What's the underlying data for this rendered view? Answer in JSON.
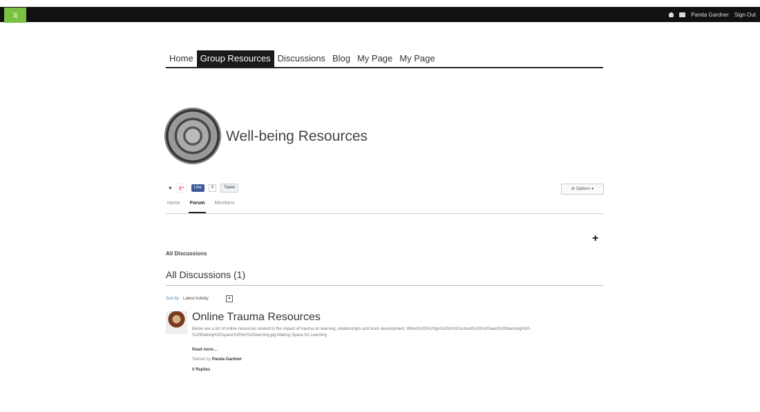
{
  "topbar": {
    "logo_text": "3|",
    "logo_color": "#7bc043",
    "icons": [
      "user-icon",
      "message-icon"
    ],
    "user_name": "Panda Gardner",
    "sign_out": "Sign Out"
  },
  "nav": {
    "items": [
      "Home",
      "Group Resources",
      "Discussions",
      "Blog",
      "My Page",
      "My Page"
    ],
    "active_index": 1
  },
  "group": {
    "title": "Well-being Resources"
  },
  "social": {
    "fb_like": "Like",
    "fb_count": "0",
    "tweet": "Tweet",
    "options": "Options"
  },
  "subtabs": {
    "items": [
      "Home",
      "Forum",
      "Members"
    ],
    "active_index": 1
  },
  "discussions": {
    "section_label": "All Discussions",
    "heading": "All Discussions (1)",
    "sort_label": "Sort by",
    "sort_value": "Latest Activity",
    "items": [
      {
        "title": "Online Trauma Resources",
        "excerpt": "Below are a list of online resources related to the impact of trauma on learning, relationships and brain development. When%20I%20go%20to%20school%20I%20want%20learning%20-%20Making%20space%20for%20learning.jpg Making Space for Learning",
        "read_more": "Read more…",
        "started_by_label": "Started by",
        "author": "Panda Gardner",
        "replies": "0 Replies"
      }
    ]
  },
  "footer": {
    "left": "",
    "right": ""
  }
}
